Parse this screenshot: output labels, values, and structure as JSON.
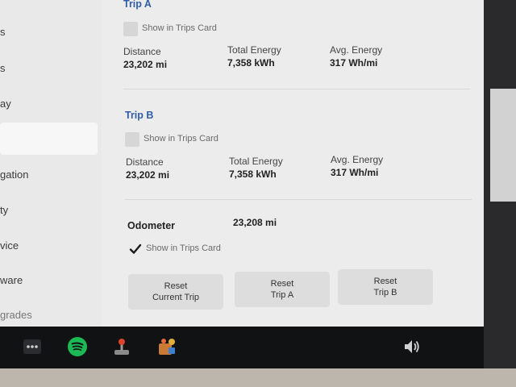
{
  "sidebar": {
    "items": [
      "s",
      "s",
      "ay",
      "",
      "gation",
      "ty",
      "vice",
      "ware",
      "grades"
    ]
  },
  "trip_a": {
    "title": "Trip A",
    "show_label": "Show in Trips Card",
    "distance_label": "Distance",
    "distance_value": "23,202 mi",
    "energy_label": "Total Energy",
    "energy_value": "7,358 kWh",
    "avg_label": "Avg. Energy",
    "avg_value": "317 Wh/mi"
  },
  "trip_b": {
    "title": "Trip B",
    "show_label": "Show in Trips Card",
    "distance_label": "Distance",
    "distance_value": "23,202 mi",
    "energy_label": "Total Energy",
    "energy_value": "7,358 kWh",
    "avg_label": "Avg. Energy",
    "avg_value": "317 Wh/mi"
  },
  "odometer": {
    "label": "Odometer",
    "value": "23,208 mi",
    "show_label": "Show in Trips Card",
    "checked": true
  },
  "buttons": {
    "reset_current_line1": "Reset",
    "reset_current_line2": "Current Trip",
    "reset_a_line1": "Reset",
    "reset_a_line2": "Trip A",
    "reset_b_line1": "Reset",
    "reset_b_line2": "Trip B"
  },
  "taskbar": {
    "icons": [
      "more-icon",
      "spotify-icon",
      "joystick-icon",
      "toybox-icon",
      "volume-icon"
    ]
  },
  "colors": {
    "trip_title": "#2f5ea6",
    "spotify": "#1db954",
    "screen_bg": "#ececec"
  }
}
